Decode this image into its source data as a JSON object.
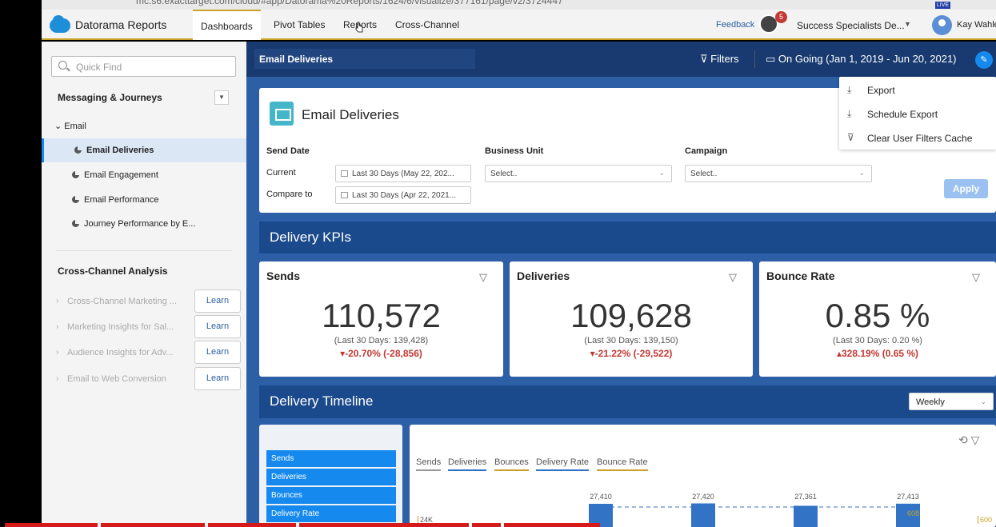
{
  "browser": {
    "url": "mc.s6.exacttarget.com/cloud/#app/Datorama%20Reports/1624/6/visualize/377161/page/v2/3724447",
    "live_badge": "LIVE"
  },
  "topnav": {
    "app_name": "Datorama Reports",
    "tabs": [
      "Dashboards",
      "Pivot Tables",
      "Reports",
      "Cross-Channel"
    ],
    "active_tab": "Dashboards",
    "feedback": "Feedback",
    "notification_count": "5",
    "org_name": "Success Specialists De...",
    "user_name": "Kay Wahle"
  },
  "sidebar": {
    "search_placeholder": "Quick Find",
    "section_messaging": "Messaging & Journeys",
    "tree_email": "Email",
    "items": [
      {
        "label": "Email Deliveries",
        "selected": true
      },
      {
        "label": "Email Engagement",
        "selected": false
      },
      {
        "label": "Email Performance",
        "selected": false
      },
      {
        "label": "Journey Performance by E...",
        "selected": false
      }
    ],
    "section_cross": "Cross-Channel Analysis",
    "learn_items": [
      {
        "label": "Cross-Channel Marketing ...",
        "button": "Learn"
      },
      {
        "label": "Marketing Insights for Sal...",
        "button": "Learn"
      },
      {
        "label": "Audience Insights for Adv...",
        "button": "Learn"
      },
      {
        "label": "Email to Web Conversion",
        "button": "Learn"
      }
    ]
  },
  "header": {
    "dashboard_name": "Email Deliveries",
    "filters": "Filters",
    "date_range": "On Going (Jan 1, 2019 - Jun 20, 2021)"
  },
  "menu": {
    "items": [
      {
        "icon": "download-icon",
        "label": "Export"
      },
      {
        "icon": "schedule-export-icon",
        "label": "Schedule Export"
      },
      {
        "icon": "clear-filter-icon",
        "label": "Clear User Filters Cache"
      }
    ]
  },
  "filters_card": {
    "title": "Email Deliveries",
    "send_date": "Send Date",
    "current": "Current",
    "compare_to": "Compare to",
    "current_value": "Last 30 Days (May 22, 202...",
    "compare_value": "Last 30 Days (Apr 22, 2021...",
    "business_unit": "Business Unit",
    "business_unit_value": "Select..",
    "campaign": "Campaign",
    "campaign_value": "Select..",
    "apply": "Apply"
  },
  "kpis": {
    "banner": "Delivery KPIs",
    "cards": [
      {
        "title": "Sends",
        "value": "110,572",
        "last": "(Last 30 Days: 139,428)",
        "change": "-20.70% (-28,856)",
        "direction": "down"
      },
      {
        "title": "Deliveries",
        "value": "109,628",
        "last": "(Last 30 Days: 139,150)",
        "change": "-21.22% (-29,522)",
        "direction": "down"
      },
      {
        "title": "Bounce Rate",
        "value": "0.85 %",
        "last": "(Last 30 Days: 0.20 %)",
        "change": "328.19% (0.65 %)",
        "direction": "up"
      }
    ]
  },
  "timeline": {
    "banner": "Delivery Timeline",
    "granularity": "Weekly",
    "metrics": [
      "Sends",
      "Deliveries",
      "Bounces",
      "Delivery Rate"
    ],
    "legend": [
      "Sends",
      "Deliveries",
      "Bounces",
      "Delivery Rate",
      "Bounce Rate"
    ],
    "legend_colors": [
      "#999999",
      "#3273c6",
      "#c9a227",
      "#3273c6",
      "#c9a227"
    ],
    "y_tick": "24K",
    "y2_tick": "600",
    "y2_mark": "608",
    "bar_labels": [
      "27,410",
      "27,420",
      "27,361",
      "27,413"
    ]
  },
  "chart_data": {
    "type": "bar",
    "categories": [
      "",
      "",
      "",
      ""
    ],
    "series": [
      {
        "name": "Sends",
        "values": [
          27410,
          27420,
          27361,
          27413
        ]
      }
    ]
  },
  "colors": {
    "nav_accent": "#c9a227",
    "header_bg": "#183a70",
    "dashboard_bg": "#2d5fa6",
    "primary_button": "#1589ee",
    "negative": "#c23934"
  }
}
